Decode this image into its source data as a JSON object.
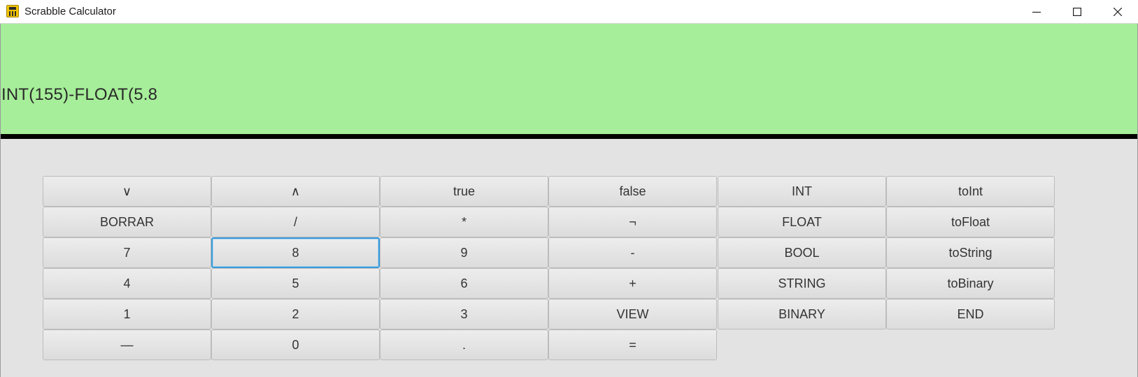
{
  "window": {
    "title": "Scrabble Calculator",
    "controls": [
      "minimize",
      "maximize",
      "close"
    ]
  },
  "display": {
    "expression": "INT(155)-FLOAT(5.8",
    "background": "#a6ee99"
  },
  "keypad": {
    "focused_key": "8",
    "rows": [
      [
        "∨",
        "∧",
        "true",
        "false",
        "INT",
        "toInt"
      ],
      [
        "BORRAR",
        "/",
        "*",
        "¬",
        "FLOAT",
        "toFloat"
      ],
      [
        "7",
        "8",
        "9",
        "-",
        "BOOL",
        "toString"
      ],
      [
        "4",
        "5",
        "6",
        "+",
        "STRING",
        "toBinary"
      ],
      [
        "1",
        "2",
        "3",
        "VIEW",
        "BINARY",
        "END"
      ],
      [
        "—",
        "0",
        ".",
        "="
      ]
    ]
  }
}
